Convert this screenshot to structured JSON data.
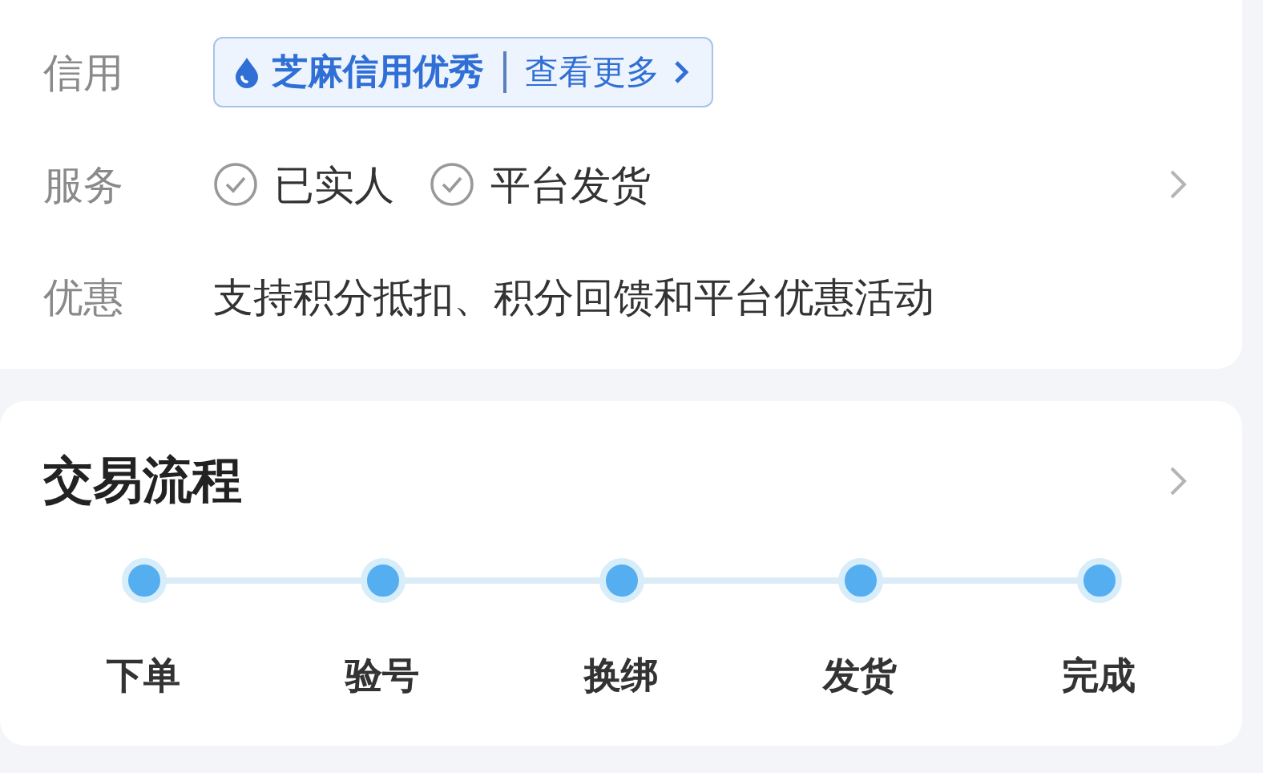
{
  "info_rows": [
    {
      "kind": "badge",
      "label": "信用",
      "badge": {
        "rating": "芝麻信用优秀",
        "link": "查看更多"
      }
    },
    {
      "kind": "services",
      "label": "服务",
      "items": [
        "已实人",
        "平台发货"
      ]
    },
    {
      "kind": "text",
      "label": "优惠",
      "text": "支持积分抵扣、积分回馈和平台优惠活动"
    }
  ],
  "process": {
    "title": "交易流程",
    "steps": [
      "下单",
      "验号",
      "换绑",
      "发货",
      "完成"
    ]
  }
}
